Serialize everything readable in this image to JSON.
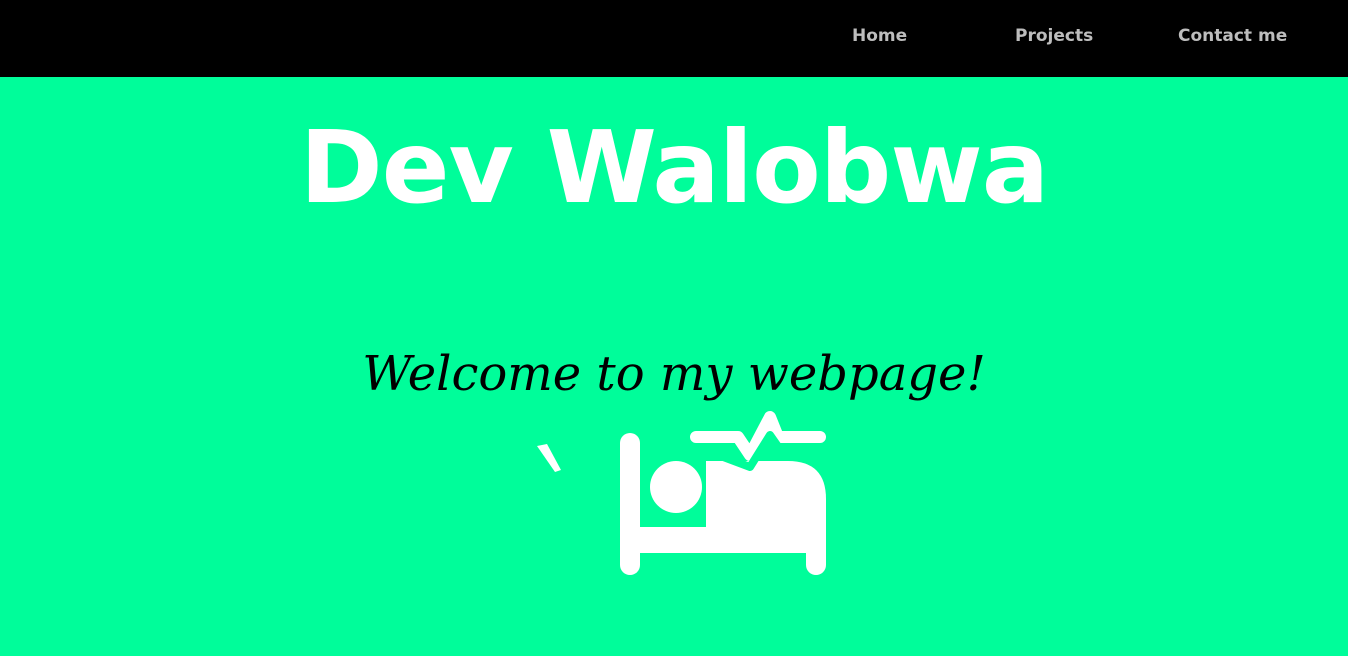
{
  "nav": {
    "home": "Home",
    "projects": "Projects",
    "contact": "Contact me"
  },
  "hero": {
    "title": "Dev Walobwa",
    "welcome": "Welcome to my webpage!",
    "stray_char": "`",
    "icon": "hospital-bed-icon"
  },
  "colors": {
    "background": "#00fd9a",
    "navbar": "#000000",
    "nav_text": "#bdbdbd",
    "title_text": "#ffffff",
    "welcome_text": "#000000"
  }
}
